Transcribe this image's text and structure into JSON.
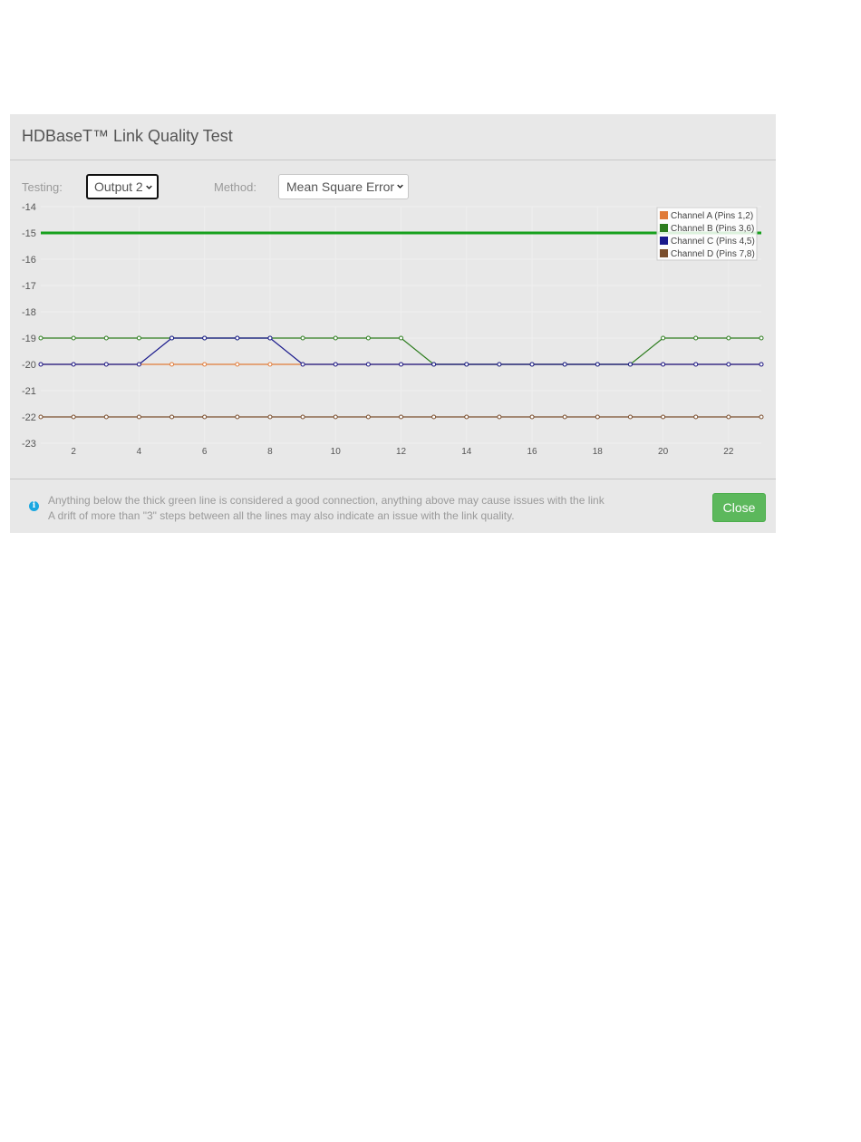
{
  "dialog": {
    "title": "HDBaseT™ Link Quality Test",
    "testing_label": "Testing:",
    "testing_value": "Output 2",
    "method_label": "Method:",
    "method_value": "Mean Square Error",
    "footer_line1": "Anything below the thick green line is considered a good connection, anything above may cause issues with the link",
    "footer_line2": "A drift of more than \"3\" steps between all the lines may also indicate an issue with the link quality.",
    "close_label": "Close",
    "info_icon": "info-circle-icon",
    "accent_green": "#5cb85c"
  },
  "chart_data": {
    "type": "line",
    "x": [
      1,
      2,
      3,
      4,
      5,
      6,
      7,
      8,
      9,
      10,
      11,
      12,
      13,
      14,
      15,
      16,
      17,
      18,
      19,
      20,
      21,
      22,
      23
    ],
    "xticks": [
      2,
      4,
      6,
      8,
      10,
      12,
      14,
      16,
      18,
      20,
      22
    ],
    "yticks": [
      -14,
      -15,
      -16,
      -17,
      -18,
      -19,
      -20,
      -21,
      -22,
      -23
    ],
    "xlim": [
      1,
      23
    ],
    "ylim": [
      -23,
      -14
    ],
    "grid": true,
    "legend_position": "top-right",
    "threshold": {
      "y": -15,
      "color": "#17a01d"
    },
    "series": [
      {
        "name": "Channel A (Pins 1,2)",
        "color": "#e07b39",
        "values": [
          -20,
          -20,
          -20,
          -20,
          -20,
          -20,
          -20,
          -20,
          -20,
          -20,
          -20,
          -20,
          -20,
          -20,
          -20,
          -20,
          -20,
          -20,
          -20,
          -20,
          -20,
          -20,
          -20
        ]
      },
      {
        "name": "Channel B (Pins 3,6)",
        "color": "#2e7d1f",
        "values": [
          -19,
          -19,
          -19,
          -19,
          -19,
          -19,
          -19,
          -19,
          -19,
          -19,
          -19,
          -19,
          -20,
          -20,
          -20,
          -20,
          -20,
          -20,
          -20,
          -19,
          -19,
          -19,
          -19
        ]
      },
      {
        "name": "Channel C (Pins 4,5)",
        "color": "#1a1a8c",
        "values": [
          -20,
          -20,
          -20,
          -20,
          -19,
          -19,
          -19,
          -19,
          -20,
          -20,
          -20,
          -20,
          -20,
          -20,
          -20,
          -20,
          -20,
          -20,
          -20,
          -20,
          -20,
          -20,
          -20
        ]
      },
      {
        "name": "Channel D (Pins 7,8)",
        "color": "#7a4e2d",
        "values": [
          -22,
          -22,
          -22,
          -22,
          -22,
          -22,
          -22,
          -22,
          -22,
          -22,
          -22,
          -22,
          -22,
          -22,
          -22,
          -22,
          -22,
          -22,
          -22,
          -22,
          -22,
          -22,
          -22
        ]
      }
    ]
  }
}
